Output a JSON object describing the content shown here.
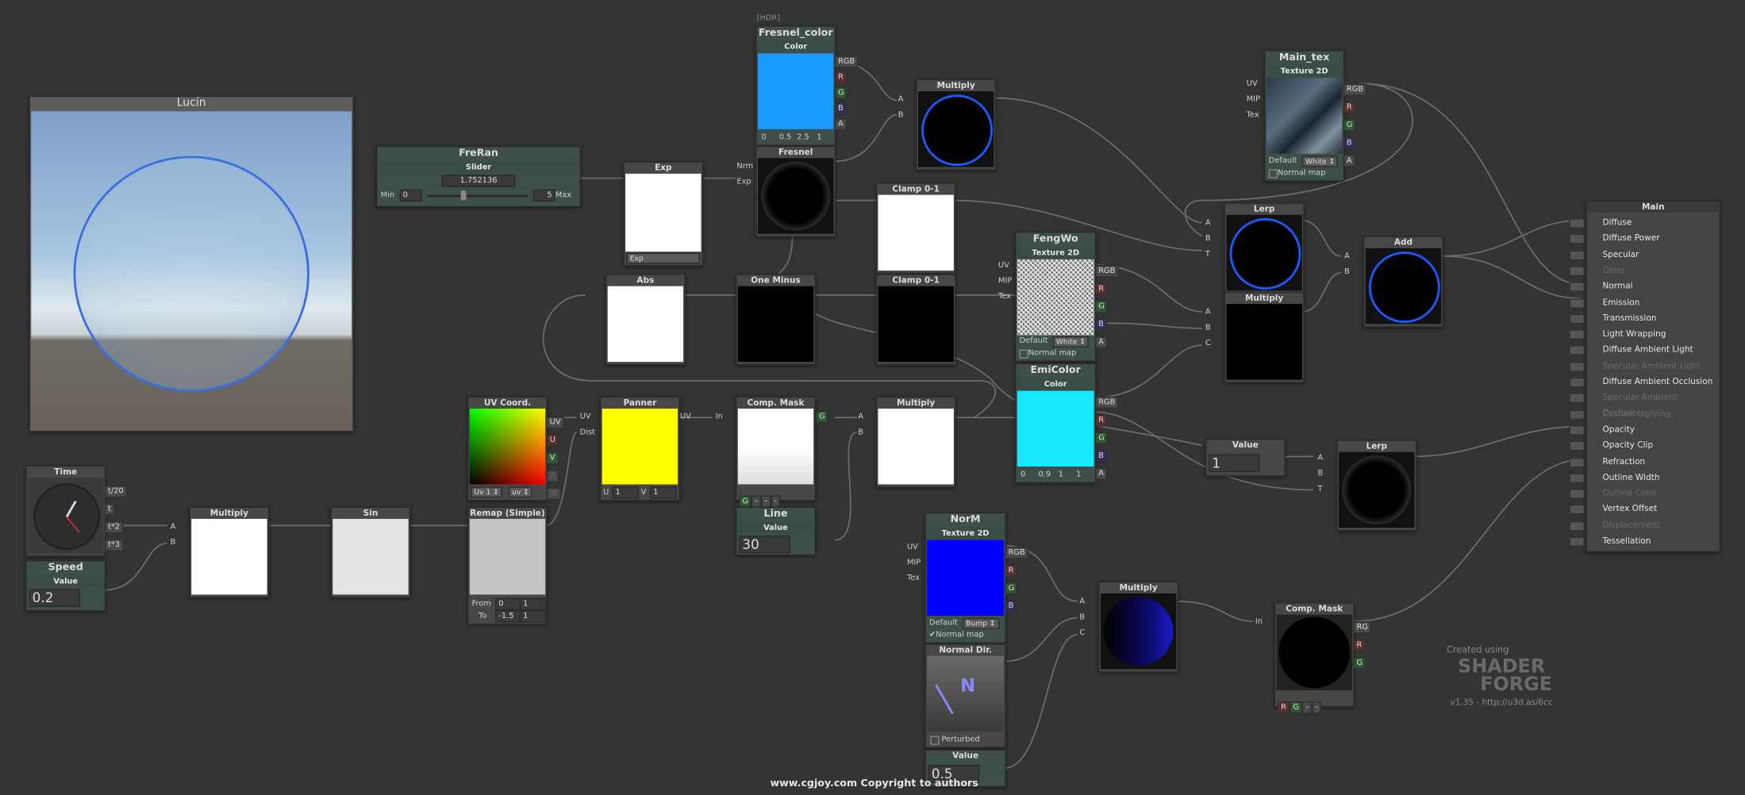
{
  "preview": {
    "title": "Lucin"
  },
  "nodes": {
    "freran": {
      "title": "FreRan",
      "sub": "Slider",
      "value": "1.752136",
      "min_label": "Min",
      "min": "0",
      "max": "5",
      "max_label": "Max"
    },
    "exp": {
      "title": "Exp",
      "dropdown": "Exp"
    },
    "hdr_tag": "[HDR]",
    "fresnel_color": {
      "title": "Fresnel_color",
      "sub": "Color",
      "vals": [
        "0",
        "0.5",
        "2.5",
        "1"
      ]
    },
    "fresnel": {
      "title": "Fresnel",
      "ports": [
        "Nrm",
        "Exp"
      ]
    },
    "multiply_top": {
      "title": "Multiply",
      "ports": [
        "A",
        "B"
      ]
    },
    "clamp1": {
      "title": "Clamp 0-1"
    },
    "clamp2": {
      "title": "Clamp 0-1"
    },
    "abs": {
      "title": "Abs"
    },
    "one_minus": {
      "title": "One Minus"
    },
    "fengwo": {
      "title": "FengWo",
      "sub": "Texture 2D",
      "ports": [
        "UV",
        "MIP",
        "Tex"
      ],
      "default": "Default",
      "white": "White ↕",
      "normal_map": "Normal map"
    },
    "emicolor": {
      "title": "EmiColor",
      "sub": "Color",
      "vals": [
        "0",
        "0.9",
        "1",
        "1"
      ]
    },
    "main_tex": {
      "title": "Main_tex",
      "sub": "Texture 2D",
      "ports": [
        "UV",
        "MIP",
        "Tex"
      ],
      "default": "Default",
      "white": "White ↕",
      "normal_map": "Normal map"
    },
    "lerp_top": {
      "title": "Lerp",
      "ports": [
        "A",
        "B",
        "T"
      ]
    },
    "multiply_mid": {
      "title": "Multiply",
      "ports": [
        "A",
        "B",
        "C"
      ]
    },
    "add": {
      "title": "Add",
      "ports": [
        "A",
        "B"
      ]
    },
    "uv_coord": {
      "title": "UV Coord.",
      "outs": [
        "UV",
        "U",
        "V",
        "Z",
        "W"
      ],
      "uv1": "Uv 1 ↕",
      "uv": "uv ↕"
    },
    "panner": {
      "title": "Panner",
      "ins": [
        "UV",
        "Dist"
      ],
      "u": "1",
      "v": "1"
    },
    "comp_mask": {
      "title": "Comp. Mask",
      "in": "In",
      "out": "G",
      "btns": [
        "G",
        "-",
        "-",
        "-"
      ]
    },
    "multiply_mid2": {
      "title": "Multiply",
      "ports": [
        "A",
        "B"
      ]
    },
    "line": {
      "title": "Line",
      "sub": "Value",
      "value": "30"
    },
    "time": {
      "title": "Time",
      "outs": [
        "t/20",
        "t",
        "t*2",
        "t*3"
      ]
    },
    "speed": {
      "title": "Speed",
      "sub": "Value",
      "value": "0.2"
    },
    "multiply_low": {
      "title": "Multiply",
      "ports": [
        "A",
        "B"
      ]
    },
    "sin": {
      "title": "Sin"
    },
    "remap": {
      "title": "Remap (Simple)",
      "from": "From",
      "from_a": "0",
      "from_b": "1",
      "to": "To",
      "to_a": "-1.5",
      "to_b": "1"
    },
    "norm": {
      "title": "NorM",
      "sub": "Texture 2D",
      "ports": [
        "UV",
        "MIP",
        "Tex"
      ],
      "default": "Default",
      "bump": "Bump ↕",
      "normal_map": "Normal map"
    },
    "normal_dir": {
      "title": "Normal Dir.",
      "perturbed": "Perturbed",
      "letter": "N"
    },
    "value_low": {
      "title": "Value",
      "value": "0.5"
    },
    "multiply_low2": {
      "title": "Multiply",
      "ports": [
        "A",
        "B",
        "C"
      ]
    },
    "comp_mask2": {
      "title": "Comp. Mask",
      "in": "In",
      "outs": [
        "RG",
        "R",
        "G"
      ],
      "btns": [
        "R",
        "G",
        "-",
        "-"
      ]
    },
    "value_mid": {
      "title": "Value",
      "value": "1"
    },
    "lerp_low": {
      "title": "Lerp",
      "ports": [
        "A",
        "B",
        "T"
      ]
    }
  },
  "main": {
    "title": "Main",
    "inputs": [
      {
        "label": "Diffuse",
        "active": true
      },
      {
        "label": "Diffuse Power",
        "active": true
      },
      {
        "label": "Specular",
        "active": true
      },
      {
        "label": "Gloss",
        "active": false
      },
      {
        "label": "Normal",
        "active": true
      },
      {
        "label": "Emission",
        "active": true
      },
      {
        "label": "Transmission",
        "active": true
      },
      {
        "label": "Light Wrapping",
        "active": true
      },
      {
        "label": "Diffuse Ambient Light",
        "active": true
      },
      {
        "label": "Specular Ambient Light",
        "active": false
      },
      {
        "label": "Diffuse Ambient Occlusion",
        "active": true
      },
      {
        "label": "Specular Ambient Occlusion",
        "active": false
      },
      {
        "label": "Custom Lighting",
        "active": false
      },
      {
        "label": "Opacity",
        "active": true
      },
      {
        "label": "Opacity Clip",
        "active": true
      },
      {
        "label": "Refraction",
        "active": true
      },
      {
        "label": "Outline Width",
        "active": true
      },
      {
        "label": "Outline Color",
        "active": false
      },
      {
        "label": "Vertex Offset",
        "active": true
      },
      {
        "label": "Displacement",
        "active": false
      },
      {
        "label": "Tessellation",
        "active": true
      }
    ]
  },
  "brand": {
    "created": "Created using",
    "line1": "SHADER",
    "line2": "FORGE",
    "version": "v1.35 - http://u3d.as/6cc"
  },
  "watermark": "www.cgjoy.com Copyright to authors",
  "colors": {
    "background": "#343434",
    "node": "#474747",
    "header": "#3e4f4a",
    "fresnel_color": "#1a9bff",
    "emicolor": "#19e6ff",
    "blue": "#0000ff",
    "yellow": "#ffff00"
  }
}
